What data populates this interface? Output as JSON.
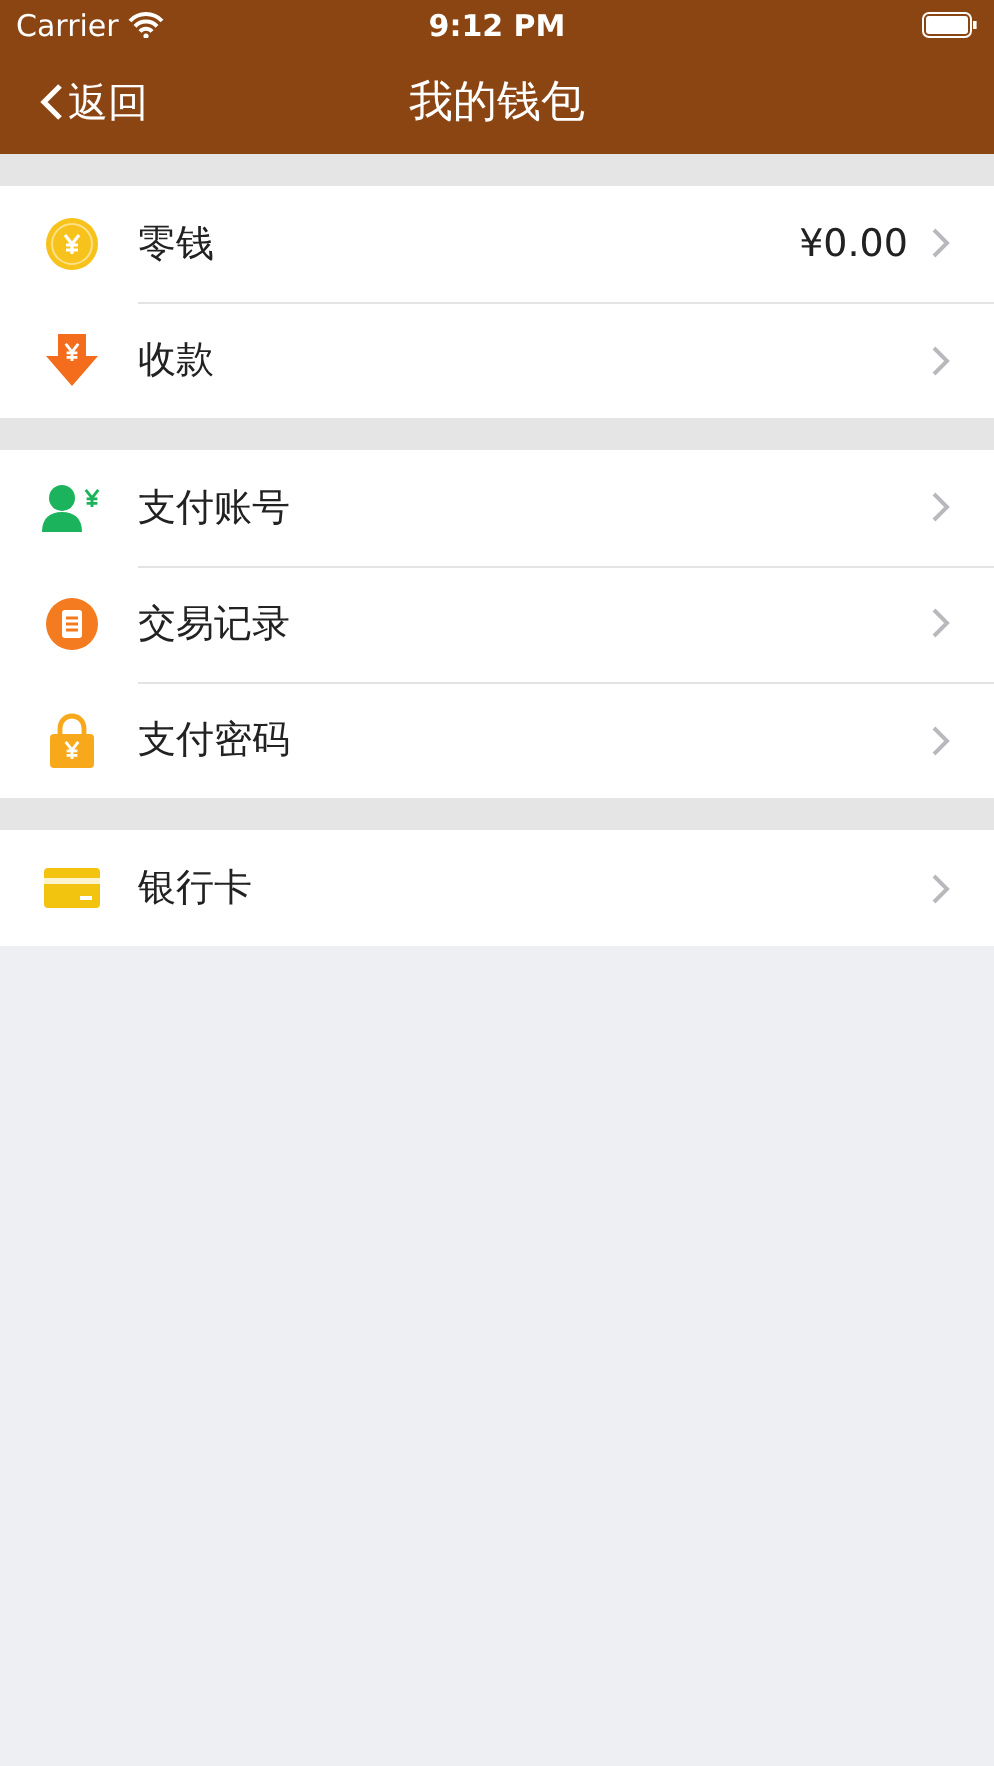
{
  "status_bar": {
    "carrier": "Carrier",
    "time": "9:12 PM"
  },
  "nav_bar": {
    "back": "返回",
    "title": "我的钱包"
  },
  "sections": [
    {
      "items": [
        {
          "label": "零钱",
          "value": "¥0.00"
        },
        {
          "label": "收款"
        }
      ]
    },
    {
      "items": [
        {
          "label": "支付账号"
        },
        {
          "label": "交易记录"
        },
        {
          "label": "支付密码"
        }
      ]
    },
    {
      "items": [
        {
          "label": "银行卡"
        }
      ]
    }
  ]
}
